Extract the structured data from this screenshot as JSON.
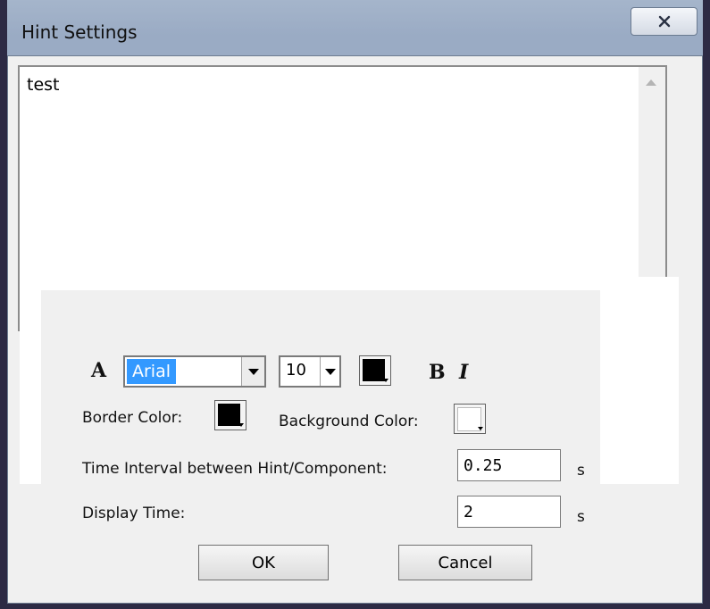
{
  "window": {
    "title": "Hint Settings",
    "close_icon": "close-icon"
  },
  "hint": {
    "text": "test"
  },
  "font": {
    "icon_glyph": "A",
    "family": "Arial",
    "size": "10",
    "color": "#000000",
    "bold_label": "B",
    "italic_label": "I"
  },
  "colors": {
    "border_label": "Border Color:",
    "border_value": "#000000",
    "background_label": "Background Color:",
    "background_value": "#ffffff"
  },
  "timing": {
    "interval_label": "Time Interval between Hint/Component:",
    "interval_value": "0.25",
    "interval_unit": "s",
    "display_label": "Display Time:",
    "display_value": "2",
    "display_unit": "s"
  },
  "buttons": {
    "ok": "OK",
    "cancel": "Cancel"
  }
}
